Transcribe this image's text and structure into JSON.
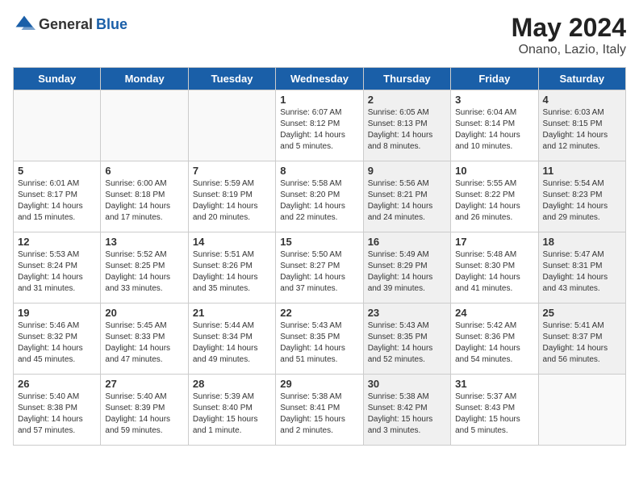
{
  "header": {
    "logo_general": "General",
    "logo_blue": "Blue",
    "title": "May 2024",
    "subtitle": "Onano, Lazio, Italy"
  },
  "weekdays": [
    "Sunday",
    "Monday",
    "Tuesday",
    "Wednesday",
    "Thursday",
    "Friday",
    "Saturday"
  ],
  "weeks": [
    [
      {
        "day": "",
        "info": "",
        "shaded": false,
        "empty": true
      },
      {
        "day": "",
        "info": "",
        "shaded": false,
        "empty": true
      },
      {
        "day": "",
        "info": "",
        "shaded": false,
        "empty": true
      },
      {
        "day": "1",
        "info": "Sunrise: 6:07 AM\nSunset: 8:12 PM\nDaylight: 14 hours\nand 5 minutes.",
        "shaded": false,
        "empty": false
      },
      {
        "day": "2",
        "info": "Sunrise: 6:05 AM\nSunset: 8:13 PM\nDaylight: 14 hours\nand 8 minutes.",
        "shaded": true,
        "empty": false
      },
      {
        "day": "3",
        "info": "Sunrise: 6:04 AM\nSunset: 8:14 PM\nDaylight: 14 hours\nand 10 minutes.",
        "shaded": false,
        "empty": false
      },
      {
        "day": "4",
        "info": "Sunrise: 6:03 AM\nSunset: 8:15 PM\nDaylight: 14 hours\nand 12 minutes.",
        "shaded": true,
        "empty": false
      }
    ],
    [
      {
        "day": "5",
        "info": "Sunrise: 6:01 AM\nSunset: 8:17 PM\nDaylight: 14 hours\nand 15 minutes.",
        "shaded": false,
        "empty": false
      },
      {
        "day": "6",
        "info": "Sunrise: 6:00 AM\nSunset: 8:18 PM\nDaylight: 14 hours\nand 17 minutes.",
        "shaded": false,
        "empty": false
      },
      {
        "day": "7",
        "info": "Sunrise: 5:59 AM\nSunset: 8:19 PM\nDaylight: 14 hours\nand 20 minutes.",
        "shaded": false,
        "empty": false
      },
      {
        "day": "8",
        "info": "Sunrise: 5:58 AM\nSunset: 8:20 PM\nDaylight: 14 hours\nand 22 minutes.",
        "shaded": false,
        "empty": false
      },
      {
        "day": "9",
        "info": "Sunrise: 5:56 AM\nSunset: 8:21 PM\nDaylight: 14 hours\nand 24 minutes.",
        "shaded": true,
        "empty": false
      },
      {
        "day": "10",
        "info": "Sunrise: 5:55 AM\nSunset: 8:22 PM\nDaylight: 14 hours\nand 26 minutes.",
        "shaded": false,
        "empty": false
      },
      {
        "day": "11",
        "info": "Sunrise: 5:54 AM\nSunset: 8:23 PM\nDaylight: 14 hours\nand 29 minutes.",
        "shaded": true,
        "empty": false
      }
    ],
    [
      {
        "day": "12",
        "info": "Sunrise: 5:53 AM\nSunset: 8:24 PM\nDaylight: 14 hours\nand 31 minutes.",
        "shaded": false,
        "empty": false
      },
      {
        "day": "13",
        "info": "Sunrise: 5:52 AM\nSunset: 8:25 PM\nDaylight: 14 hours\nand 33 minutes.",
        "shaded": false,
        "empty": false
      },
      {
        "day": "14",
        "info": "Sunrise: 5:51 AM\nSunset: 8:26 PM\nDaylight: 14 hours\nand 35 minutes.",
        "shaded": false,
        "empty": false
      },
      {
        "day": "15",
        "info": "Sunrise: 5:50 AM\nSunset: 8:27 PM\nDaylight: 14 hours\nand 37 minutes.",
        "shaded": false,
        "empty": false
      },
      {
        "day": "16",
        "info": "Sunrise: 5:49 AM\nSunset: 8:29 PM\nDaylight: 14 hours\nand 39 minutes.",
        "shaded": true,
        "empty": false
      },
      {
        "day": "17",
        "info": "Sunrise: 5:48 AM\nSunset: 8:30 PM\nDaylight: 14 hours\nand 41 minutes.",
        "shaded": false,
        "empty": false
      },
      {
        "day": "18",
        "info": "Sunrise: 5:47 AM\nSunset: 8:31 PM\nDaylight: 14 hours\nand 43 minutes.",
        "shaded": true,
        "empty": false
      }
    ],
    [
      {
        "day": "19",
        "info": "Sunrise: 5:46 AM\nSunset: 8:32 PM\nDaylight: 14 hours\nand 45 minutes.",
        "shaded": false,
        "empty": false
      },
      {
        "day": "20",
        "info": "Sunrise: 5:45 AM\nSunset: 8:33 PM\nDaylight: 14 hours\nand 47 minutes.",
        "shaded": false,
        "empty": false
      },
      {
        "day": "21",
        "info": "Sunrise: 5:44 AM\nSunset: 8:34 PM\nDaylight: 14 hours\nand 49 minutes.",
        "shaded": false,
        "empty": false
      },
      {
        "day": "22",
        "info": "Sunrise: 5:43 AM\nSunset: 8:35 PM\nDaylight: 14 hours\nand 51 minutes.",
        "shaded": false,
        "empty": false
      },
      {
        "day": "23",
        "info": "Sunrise: 5:43 AM\nSunset: 8:35 PM\nDaylight: 14 hours\nand 52 minutes.",
        "shaded": true,
        "empty": false
      },
      {
        "day": "24",
        "info": "Sunrise: 5:42 AM\nSunset: 8:36 PM\nDaylight: 14 hours\nand 54 minutes.",
        "shaded": false,
        "empty": false
      },
      {
        "day": "25",
        "info": "Sunrise: 5:41 AM\nSunset: 8:37 PM\nDaylight: 14 hours\nand 56 minutes.",
        "shaded": true,
        "empty": false
      }
    ],
    [
      {
        "day": "26",
        "info": "Sunrise: 5:40 AM\nSunset: 8:38 PM\nDaylight: 14 hours\nand 57 minutes.",
        "shaded": false,
        "empty": false
      },
      {
        "day": "27",
        "info": "Sunrise: 5:40 AM\nSunset: 8:39 PM\nDaylight: 14 hours\nand 59 minutes.",
        "shaded": false,
        "empty": false
      },
      {
        "day": "28",
        "info": "Sunrise: 5:39 AM\nSunset: 8:40 PM\nDaylight: 15 hours\nand 1 minute.",
        "shaded": false,
        "empty": false
      },
      {
        "day": "29",
        "info": "Sunrise: 5:38 AM\nSunset: 8:41 PM\nDaylight: 15 hours\nand 2 minutes.",
        "shaded": false,
        "empty": false
      },
      {
        "day": "30",
        "info": "Sunrise: 5:38 AM\nSunset: 8:42 PM\nDaylight: 15 hours\nand 3 minutes.",
        "shaded": true,
        "empty": false
      },
      {
        "day": "31",
        "info": "Sunrise: 5:37 AM\nSunset: 8:43 PM\nDaylight: 15 hours\nand 5 minutes.",
        "shaded": false,
        "empty": false
      },
      {
        "day": "",
        "info": "",
        "shaded": true,
        "empty": true
      }
    ]
  ]
}
